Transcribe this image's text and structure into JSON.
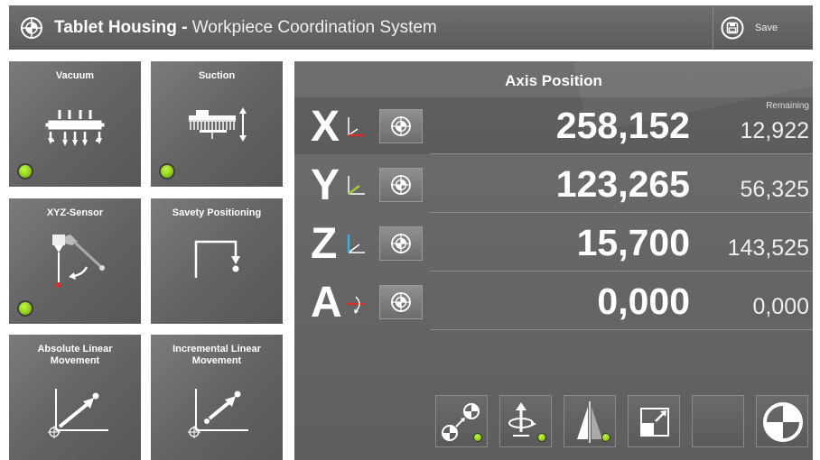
{
  "header": {
    "title_bold": "Tablet Housing -",
    "title_rest": " Workpiece Coordination System",
    "save_label": "Save",
    "icon": "crosshair-icon",
    "save_icon": "save-icon"
  },
  "tiles": [
    {
      "label": "Vacuum",
      "icon": "vacuum-icon",
      "status": "active"
    },
    {
      "label": "Suction",
      "icon": "suction-icon",
      "status": "active"
    },
    {
      "label": "XYZ-Sensor",
      "icon": "xyz-sensor-icon",
      "status": "active"
    },
    {
      "label": "Savety Positioning",
      "icon": "safety-positioning-icon"
    },
    {
      "label": "Absolute Linear Movement",
      "icon": "absolute-linear-movement-icon"
    },
    {
      "label": "Incremental Linear Movement",
      "icon": "incremental-linear-movement-icon"
    }
  ],
  "axis_panel": {
    "title": "Axis Position",
    "remaining_label": "Remaining",
    "axes": [
      {
        "letter": "X",
        "value": "258,152",
        "remaining": "12,922",
        "color": "#d32f2f"
      },
      {
        "letter": "Y",
        "value": "123,265",
        "remaining": "56,325",
        "color": "#9ccc3c"
      },
      {
        "letter": "Z",
        "value": "15,700",
        "remaining": "143,525",
        "color": "#3fa9e0"
      },
      {
        "letter": "A",
        "value": "0,000",
        "remaining": "0,000",
        "color": "#d32f2f"
      }
    ]
  },
  "toolbar": [
    {
      "icon": "coordinate-transfer-icon",
      "status": "active"
    },
    {
      "icon": "rotate-axis-icon",
      "status": "active"
    },
    {
      "icon": "mirror-icon",
      "status": "active"
    },
    {
      "icon": "scale-icon"
    },
    {
      "icon": "empty-slot"
    },
    {
      "icon": "origin-icon"
    }
  ],
  "colors": {
    "led_green": "#8fd11a",
    "panel": "#656565"
  }
}
